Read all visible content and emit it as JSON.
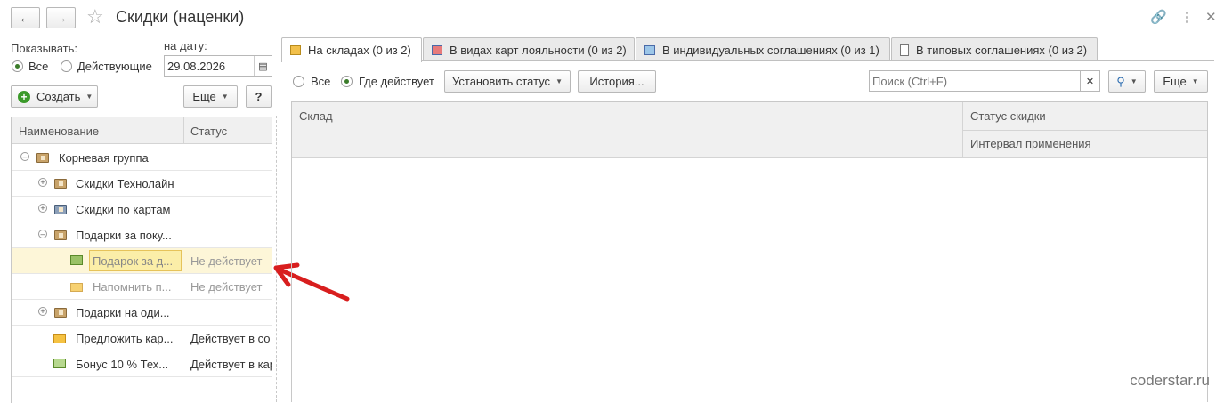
{
  "header": {
    "title": "Скидки (наценки)"
  },
  "left": {
    "show_label": "Показывать:",
    "date_label": "на дату:",
    "radio_all": "Все",
    "radio_active": "Действующие",
    "date_value": "29.08.2026",
    "create_label": "Создать",
    "more_label": "Еще",
    "help_label": "?",
    "columns": [
      "Наименование",
      "Статус"
    ],
    "rows": [
      {
        "name": "Корневая группа",
        "status": ""
      },
      {
        "name": "Скидки Технолайн",
        "status": ""
      },
      {
        "name": "Скидки по картам",
        "status": ""
      },
      {
        "name": "Подарки за поку...",
        "status": ""
      },
      {
        "name": "Подарок за д...",
        "status": "Не действует"
      },
      {
        "name": "Напомнить п...",
        "status": "Не действует"
      },
      {
        "name": "Подарки на оди...",
        "status": ""
      },
      {
        "name": "Предложить кар...",
        "status": "Действует в со"
      },
      {
        "name": "Бонус 10 % Тех...",
        "status": "Действует в кар"
      }
    ]
  },
  "tabs": [
    {
      "label": "На складах (0 из 2)"
    },
    {
      "label": "В видах карт лояльности (0 из 2)"
    },
    {
      "label": "В индивидуальных соглашениях (0 из 1)"
    },
    {
      "label": "В типовых соглашениях (0 из 2)"
    }
  ],
  "right": {
    "radio_all": "Все",
    "radio_where": "Где действует",
    "set_status_label": "Установить статус",
    "history_label": "История...",
    "search_placeholder": "Поиск (Ctrl+F)",
    "more_label": "Еще",
    "col_warehouse": "Склад",
    "col_status": "Статус скидки",
    "col_interval": "Интервал применения"
  },
  "watermark": "coderstar.ru",
  "colors": {
    "accent_green": "#3b9a2a",
    "selection": "#fbeea8",
    "arrow": "#d81e1e"
  }
}
